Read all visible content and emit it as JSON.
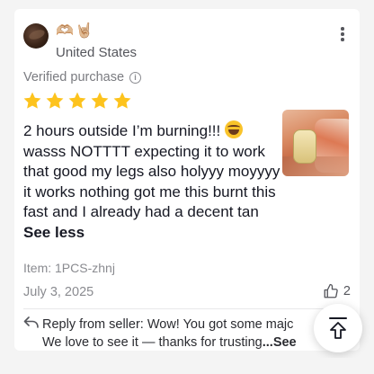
{
  "reviewer": {
    "emojis": "🫶🏼🤘🏼",
    "country": "United States"
  },
  "verified_label": "Verified purchase",
  "rating": 5,
  "review": {
    "text_before_emoji": "2 hours outside I’m burning!!! ",
    "text_after_emoji": "wasss NOTTTT expecting it to work that good my legs also holyyy moyyyy it works nothing got me this burnt this fast and I already had a decent tan",
    "see_less": "See less"
  },
  "item": "Item: 1PCS-zhnj",
  "date": "July 3, 2025",
  "likes": "2",
  "reply": {
    "line1": "Reply from seller: Wow! You got some majc",
    "line2": "We love to see it — thanks for trusting",
    "see_more": "...See"
  },
  "colors": {
    "star": "#fdc31d",
    "text": "#161823",
    "muted": "#8a8b90"
  },
  "icons": {
    "more": "more-vertical-icon",
    "info": "info-icon",
    "star": "star-icon",
    "like": "thumbs-up-icon",
    "reply": "reply-arrow-icon",
    "scroll_top": "arrow-up-to-top-icon"
  }
}
